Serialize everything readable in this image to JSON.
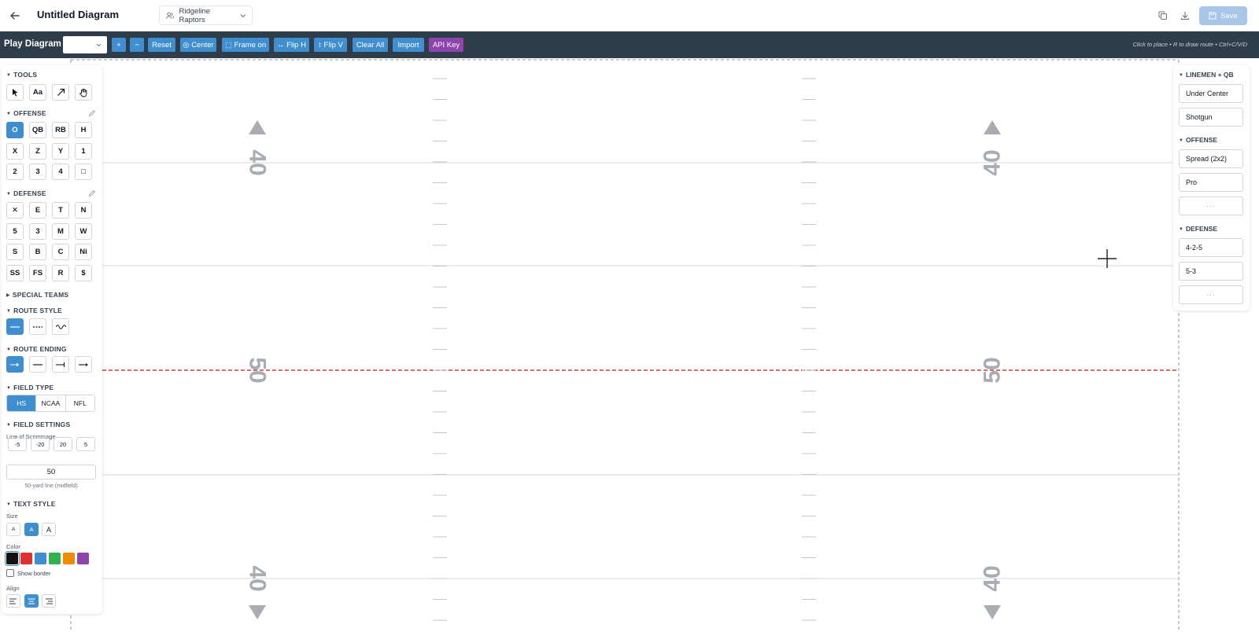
{
  "header": {
    "title": "Untitled Diagram",
    "team": "Ridgeline Raptors",
    "save_label": "Save"
  },
  "toolbar": {
    "title": "Play Diagram",
    "buttons": [
      "+",
      "−",
      "Reset",
      "◎ Center",
      "⬚ Frame on",
      "↔ Flip H",
      "↕ Flip V",
      "Clear All",
      "Import",
      "API Key"
    ],
    "hint": "Click to place • R to draw route • Ctrl+C/V/D"
  },
  "field": {
    "yard_labels_top": [
      "40",
      "40"
    ],
    "yard_labels_mid": [
      "50",
      "50"
    ],
    "yard_labels_bottom": [
      "40",
      "40"
    ]
  },
  "left_panel": {
    "tools": {
      "label": "TOOLS",
      "items": [
        "pointer",
        "Aa",
        "arrow",
        "hand"
      ]
    },
    "offense": {
      "label": "OFFENSE",
      "items": [
        "O",
        "QB",
        "RB",
        "H",
        "X",
        "Z",
        "Y",
        "1",
        "2",
        "3",
        "4",
        "□"
      ]
    },
    "defense": {
      "label": "DEFENSE",
      "items": [
        "✕",
        "E",
        "T",
        "N",
        "5",
        "3",
        "M",
        "W",
        "S",
        "B",
        "C",
        "Ni",
        "SS",
        "FS",
        "R",
        "$"
      ]
    },
    "special_teams": {
      "label": "SPECIAL TEAMS"
    },
    "route_style": {
      "label": "ROUTE STYLE",
      "options": [
        "solid",
        "dashed",
        "wavy"
      ],
      "selected": "solid"
    },
    "route_ending": {
      "label": "ROUTE ENDING",
      "options": [
        "arrow",
        "none",
        "block",
        "arrow-end"
      ],
      "selected": "arrow"
    },
    "field_type": {
      "label": "FIELD TYPE",
      "options": [
        "HS",
        "NCAA",
        "NFL"
      ],
      "selected": "HS"
    },
    "field_settings": {
      "label": "FIELD SETTINGS",
      "los_label": "Line of Scrimmage",
      "adjust_buttons": [
        "-5",
        "-20",
        "20",
        "5"
      ],
      "los_value": "50",
      "los_caption": "50-yard line (midfield)"
    },
    "text_style": {
      "label": "TEXT STYLE",
      "size_label": "Size",
      "sizes": [
        "A",
        "A",
        "A"
      ],
      "selected_size": 1,
      "color_label": "Color",
      "colors": [
        "#111111",
        "#e03131",
        "#3f8fd0",
        "#2fb24f",
        "#f08c00",
        "#8e44ad"
      ],
      "selected_color": 0,
      "border_label": "Show border",
      "align_label": "Align",
      "selected_align": "center"
    }
  },
  "right_panel": {
    "linemen_label": "LINEMEN + QB",
    "linemen_items": [
      "Under Center",
      "Shotgun"
    ],
    "offense_label": "OFFENSE",
    "offense_items": [
      "Spread (2x2)",
      "Pro",
      "···"
    ],
    "defense_label": "DEFENSE",
    "defense_items": [
      "4-2-5",
      "5-3",
      "···"
    ]
  },
  "colors": {
    "toolbar_bg": "#2f3c4a",
    "accent": "#3f8fd0",
    "purple": "#8e44ad",
    "los_line": "#d9363e",
    "field_numbers": "#a9adb3"
  }
}
